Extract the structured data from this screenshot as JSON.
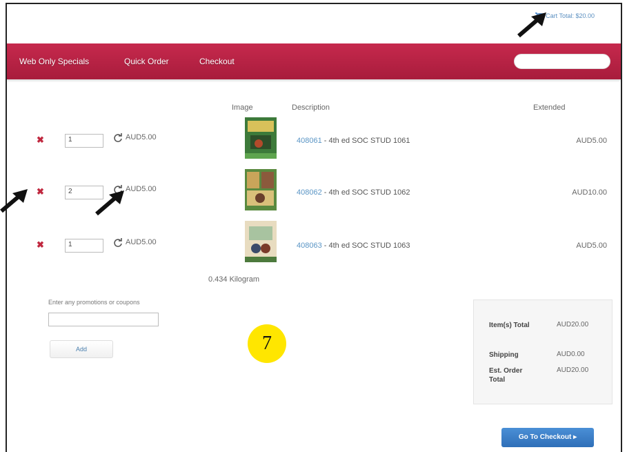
{
  "header": {
    "cart_label": "Cart Total: $20.00"
  },
  "nav": {
    "items": [
      "Web Only Specials",
      "Quick Order",
      "Checkout"
    ]
  },
  "columns": {
    "image": "Image",
    "description": "Description",
    "extended": "Extended"
  },
  "cart": {
    "rows": [
      {
        "qty": "1",
        "price": "AUD5.00",
        "sku": "408061",
        "sep": " - ",
        "title": "4th ed SOC STUD 1061",
        "extended": "AUD5.00"
      },
      {
        "qty": "2",
        "price": "AUD5.00",
        "sku": "408062",
        "sep": " - ",
        "title": "4th ed SOC STUD 1062",
        "extended": "AUD10.00"
      },
      {
        "qty": "1",
        "price": "AUD5.00",
        "sku": "408063",
        "sep": " - ",
        "title": "4th ed SOC STUD 1063",
        "extended": "AUD5.00"
      }
    ],
    "weight": "0.434 Kilogram"
  },
  "promo": {
    "label": "Enter any promotions or coupons",
    "add": "Add"
  },
  "annotation": {
    "number": "7"
  },
  "summary": {
    "items_label": "Item(s) Total",
    "items_value": "AUD20.00",
    "shipping_label": "Shipping",
    "shipping_value": "AUD0.00",
    "order_label": "Est. Order Total",
    "order_value": "AUD20.00"
  },
  "checkout_button": "Go To Checkout",
  "colors": {
    "nav": "#b8213f",
    "link": "#5a95c5",
    "remove": "#c0283f",
    "badge": "#ffe600",
    "button": "#3a7dc7"
  }
}
